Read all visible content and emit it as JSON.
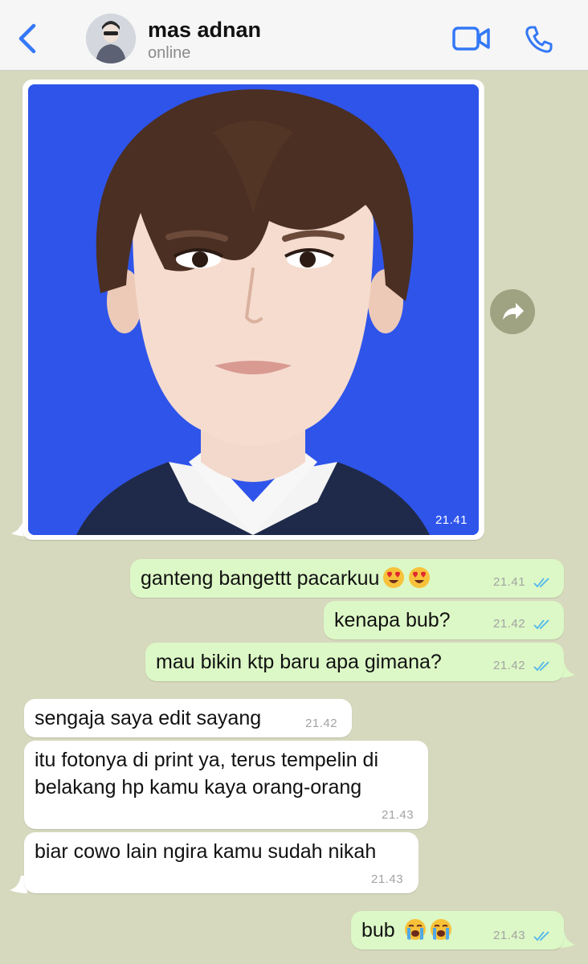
{
  "header": {
    "contact_name": "mas adnan",
    "status": "online",
    "back_icon": "chevron-left-icon",
    "video_icon": "video-camera-icon",
    "call_icon": "phone-icon",
    "accent_color": "#3478f6"
  },
  "photo_message": {
    "time": "21.41",
    "forward_icon": "forward-arrow-icon"
  },
  "messages": [
    {
      "direction": "outgoing",
      "text": "ganteng bangettt pacarkuu",
      "emoji": [
        "heart-eyes",
        "heart-eyes"
      ],
      "time": "21.41",
      "status": "read"
    },
    {
      "direction": "outgoing",
      "text": "kenapa bub?",
      "time": "21.42",
      "status": "read"
    },
    {
      "direction": "outgoing",
      "text": "mau bikin ktp baru apa gimana?",
      "time": "21.42",
      "status": "read"
    },
    {
      "direction": "incoming",
      "text": "sengaja saya edit sayang",
      "time": "21.42"
    },
    {
      "direction": "incoming",
      "text_line1": "itu fotonya di print ya, terus tempelin di",
      "text_line2": "belakang hp kamu kaya orang-orang",
      "time": "21.43"
    },
    {
      "direction": "incoming",
      "text": "biar cowo lain ngira kamu sudah nikah",
      "time": "21.43"
    },
    {
      "direction": "outgoing",
      "text": "bub",
      "emoji": [
        "loudly-crying",
        "loudly-crying"
      ],
      "time": "21.43",
      "status": "read"
    }
  ],
  "colors": {
    "chat_background": "#d6d9bd",
    "outgoing_bubble": "#dcf8c6",
    "incoming_bubble": "#ffffff",
    "read_tick": "#4fb6ec",
    "photo_background": "#2f54ea"
  }
}
